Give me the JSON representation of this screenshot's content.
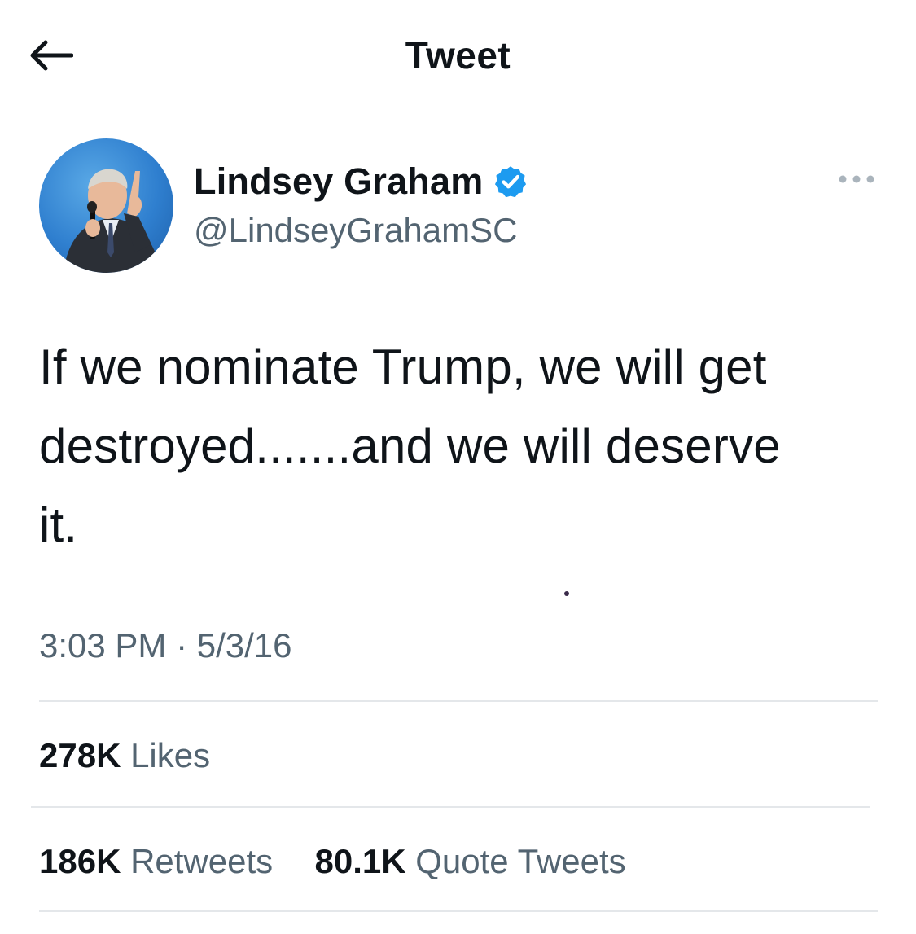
{
  "header": {
    "title": "Tweet",
    "back_icon": "arrow-left-icon"
  },
  "author": {
    "name": "Lindsey Graham",
    "handle": "@LindseyGrahamSC",
    "verified_icon": "verified-badge-icon",
    "verified_color": "#1d9bf0",
    "avatar_icon": "profile-photo"
  },
  "more_icon": "more-horizontal-icon",
  "tweet": {
    "text": "If we nominate Trump, we will get\ndestroyed.......and we will deserve\nit.",
    "timestamp": "3:03 PM · 5/3/16"
  },
  "stats": {
    "likes_count": "278K",
    "likes_label": "Likes",
    "retweets_count": "186K",
    "retweets_label": "Retweets",
    "quotes_count": "80.1K",
    "quotes_label": "Quote Tweets"
  },
  "colors": {
    "text_primary": "#0f1419",
    "text_secondary": "#536471",
    "divider": "#e4e7ea"
  }
}
